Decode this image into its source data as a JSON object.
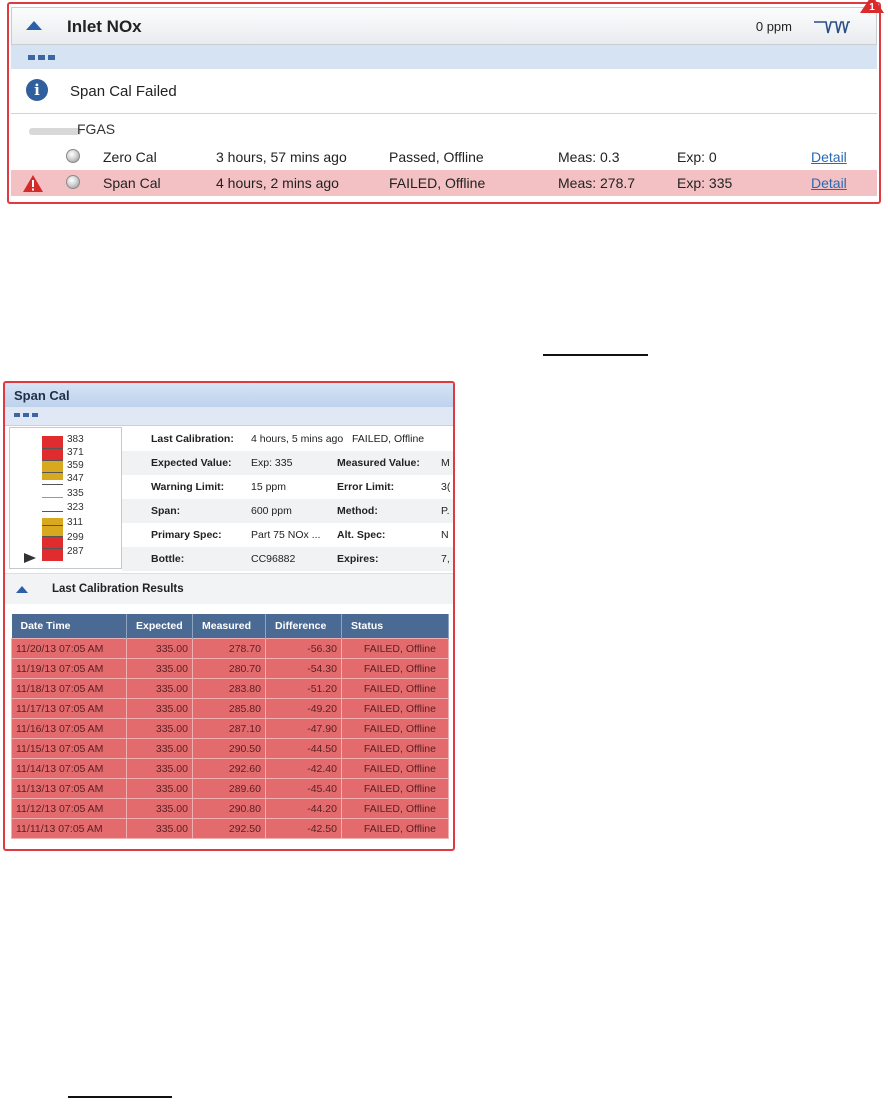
{
  "panel1": {
    "title": "Inlet NOx",
    "value": "0 ppm",
    "message": "Span Cal Failed",
    "group_label": "FGAS",
    "rows": [
      {
        "status": "ok",
        "name": "Zero Cal",
        "time": "3 hours, 57 mins ago",
        "result": "Passed, Offline",
        "meas": "Meas: 0.3",
        "exp": "Exp: 0",
        "detail": "Detail"
      },
      {
        "status": "failed",
        "name": "Span Cal",
        "time": "4 hours, 2 mins ago",
        "result": "FAILED, Offline",
        "meas": "Meas: 278.7",
        "exp": "Exp: 335",
        "detail": "Detail"
      }
    ],
    "corner_badge": "1"
  },
  "panel2": {
    "title": "Span Cal",
    "gauge": {
      "labels": [
        "383",
        "371",
        "359",
        "347",
        "335",
        "323",
        "311",
        "299",
        "287"
      ],
      "pointer_value": "287"
    },
    "details": {
      "last_calibration_label": "Last Calibration:",
      "last_calibration_value": "4 hours, 5 mins ago   FAILED, Offline",
      "expected_value_label": "Expected Value:",
      "expected_value_value": "Exp: 335",
      "measured_value_label": "Measured Value:",
      "measured_value_value": "M",
      "warning_limit_label": "Warning Limit:",
      "warning_limit_value": "15 ppm",
      "error_limit_label": "Error Limit:",
      "error_limit_value": "3(",
      "span_label": "Span:",
      "span_value": "600 ppm",
      "method_label": "Method:",
      "method_value": "P.",
      "primary_spec_label": "Primary Spec:",
      "primary_spec_value": "Part 75 NOx ...",
      "alt_spec_label": "Alt. Spec:",
      "alt_spec_value": "N",
      "bottle_label": "Bottle:",
      "bottle_value": "CC96882",
      "expires_label": "Expires:",
      "expires_value": "7,"
    },
    "results_title": "Last Calibration Results",
    "table": {
      "headers": [
        "Date Time",
        "Expected",
        "Measured",
        "Difference",
        "Status"
      ],
      "rows": [
        [
          "11/20/13 07:05 AM",
          "335.00",
          "278.70",
          "-56.30",
          "FAILED, Offline"
        ],
        [
          "11/19/13 07:05 AM",
          "335.00",
          "280.70",
          "-54.30",
          "FAILED, Offline"
        ],
        [
          "11/18/13 07:05 AM",
          "335.00",
          "283.80",
          "-51.20",
          "FAILED, Offline"
        ],
        [
          "11/17/13 07:05 AM",
          "335.00",
          "285.80",
          "-49.20",
          "FAILED, Offline"
        ],
        [
          "11/16/13 07:05 AM",
          "335.00",
          "287.10",
          "-47.90",
          "FAILED, Offline"
        ],
        [
          "11/15/13 07:05 AM",
          "335.00",
          "290.50",
          "-44.50",
          "FAILED, Offline"
        ],
        [
          "11/14/13 07:05 AM",
          "335.00",
          "292.60",
          "-42.40",
          "FAILED, Offline"
        ],
        [
          "11/13/13 07:05 AM",
          "335.00",
          "289.60",
          "-45.40",
          "FAILED, Offline"
        ],
        [
          "11/12/13 07:05 AM",
          "335.00",
          "290.80",
          "-44.20",
          "FAILED, Offline"
        ],
        [
          "11/11/13 07:05 AM",
          "335.00",
          "292.50",
          "-42.50",
          "FAILED, Offline"
        ]
      ]
    }
  },
  "colors": {
    "alert_border": "#e0393f",
    "failed_row_bg": "#f3c1c3",
    "table_header_bg": "#4a6a93",
    "table_failed_bg": "#e36b6d",
    "gauge_red": "#e02b2f",
    "gauge_yellow": "#d8a91e",
    "link": "#2a6ab5"
  },
  "icons": {
    "collapse": "triangle-up-icon",
    "info": "info-icon",
    "warning": "warning-triangle-icon",
    "status_led": "status-led-icon",
    "menu": "menu-dots-icon",
    "pointer": "gauge-pointer-icon",
    "trend": "sparkline-icon"
  }
}
